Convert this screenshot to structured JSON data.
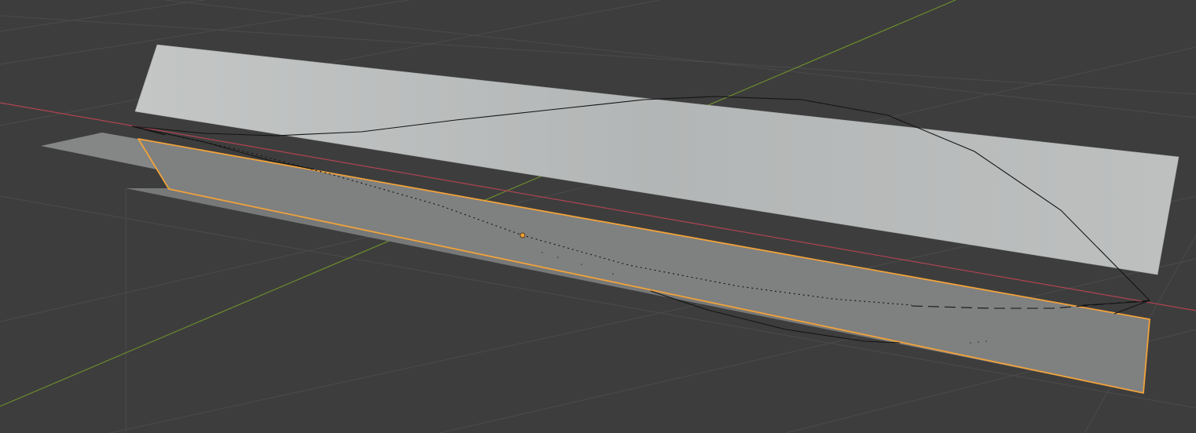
{
  "viewport": {
    "kind": "3d-viewport",
    "background_color": "#3d3d3d",
    "grid_color": "#4a4a4a",
    "x_axis_color": "#b04452",
    "y_axis_color": "#6b8c2c"
  },
  "objects": [
    {
      "name": "upright-plane",
      "selected": false,
      "shading": "solid-light",
      "color": "#b7b9b9"
    },
    {
      "name": "flat-plane",
      "selected": false,
      "shading": "solid-flat",
      "color": "#8a8b8b"
    },
    {
      "name": "selected-mesh",
      "selected": true,
      "shading": "solid-mid",
      "color": "#7d7e7e",
      "outline_color": "#f0a23b"
    },
    {
      "name": "curve-object",
      "selected": false,
      "kind": "bezier-curve",
      "color": "#111111"
    }
  ],
  "origin_marker": {
    "color": "#f0a23b"
  }
}
